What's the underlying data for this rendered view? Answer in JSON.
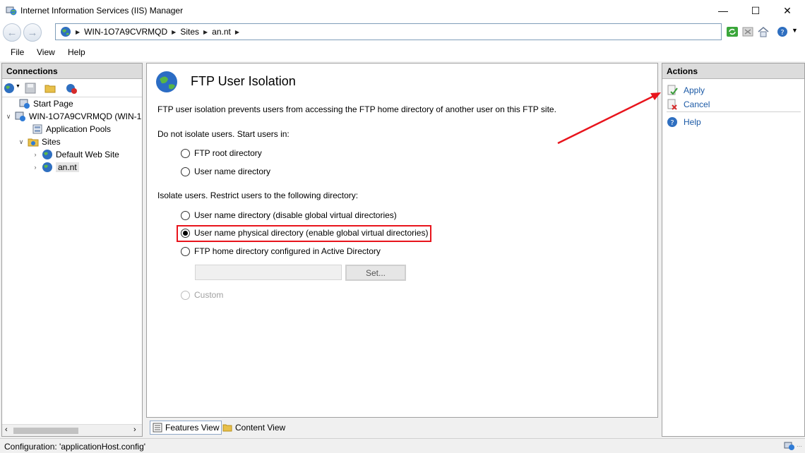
{
  "window": {
    "title": "Internet Information Services (IIS) Manager",
    "minimize": "—",
    "maximize": "☐",
    "close": "✕"
  },
  "address": {
    "crumbs": [
      "WIN-1O7A9CVRMQD",
      "Sites",
      "an.nt"
    ]
  },
  "menu": [
    "File",
    "View",
    "Help"
  ],
  "connections": {
    "header": "Connections",
    "tree": [
      {
        "label": "Start Page"
      },
      {
        "label": "WIN-1O7A9CVRMQD (WIN-1"
      },
      {
        "label": "Application Pools"
      },
      {
        "label": "Sites"
      },
      {
        "label": "Default Web Site"
      },
      {
        "label": "an.nt"
      }
    ]
  },
  "content": {
    "title": "FTP User Isolation",
    "description": "FTP user isolation prevents users from accessing the FTP home directory of another user on this FTP site.",
    "group1_label": "Do not isolate users. Start users in:",
    "group1_options": [
      "FTP root directory",
      "User name directory"
    ],
    "group2_label": "Isolate users. Restrict users to the following directory:",
    "group2_options": [
      "User name directory (disable global virtual directories)",
      "User name physical directory (enable global virtual directories)",
      "FTP home directory configured in Active Directory"
    ],
    "selected_option": "User name physical directory (enable global virtual directories)",
    "ad_path_value": "",
    "set_button": "Set...",
    "custom_option": "Custom"
  },
  "actions": {
    "header": "Actions",
    "items": [
      "Apply",
      "Cancel",
      "Help"
    ]
  },
  "view_tabs": [
    "Features View",
    "Content View"
  ],
  "status": "Configuration: 'applicationHost.config'",
  "colors": {
    "annotation_red": "#e8141c",
    "link_blue": "#1c5aa6"
  }
}
